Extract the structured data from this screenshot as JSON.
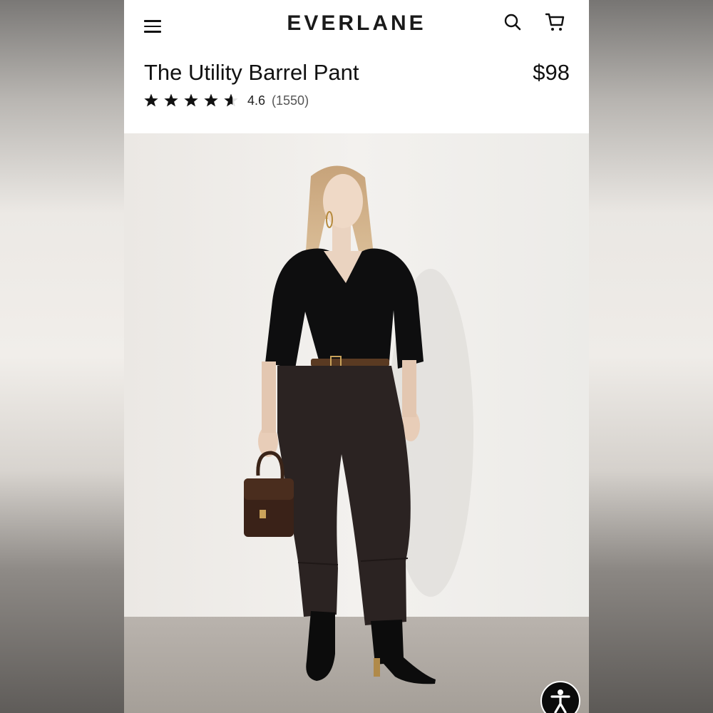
{
  "header": {
    "logo": "EVERLANE",
    "menu_icon": "hamburger-menu-icon",
    "search_icon": "search-icon",
    "cart_icon": "cart-icon"
  },
  "product": {
    "title": "The Utility Barrel Pant",
    "price": "$98",
    "rating": {
      "value": "4.6",
      "count": "(1550)",
      "stars_out_of_5": 4.6
    }
  },
  "accessibility": {
    "icon": "accessibility-icon"
  },
  "colors": {
    "text": "#111111",
    "panel_background": "#ffffff",
    "accessibility_button": "#0b0b0b"
  }
}
